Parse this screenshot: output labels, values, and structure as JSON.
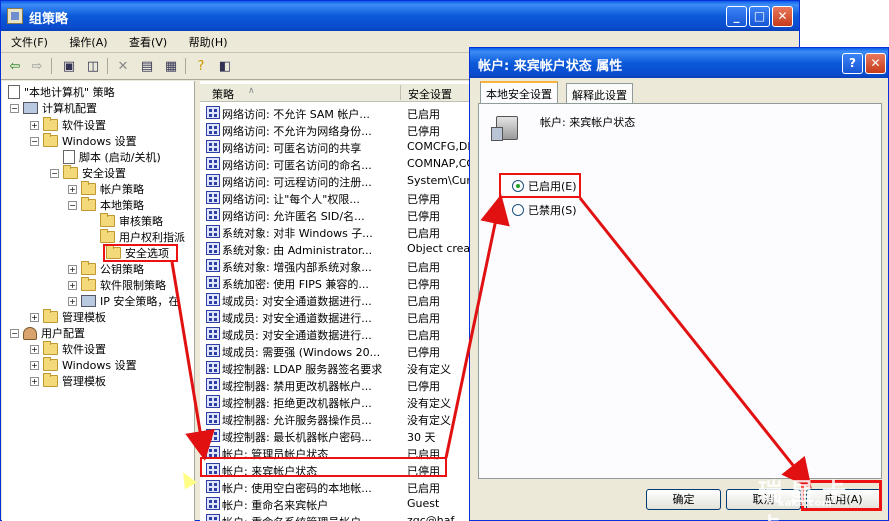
{
  "main": {
    "title": "组策略",
    "controls": {
      "min": "_",
      "max": "□",
      "close": "✕"
    },
    "menu": [
      "文件(F)",
      "操作(A)",
      "查看(V)",
      "帮助(H)"
    ]
  },
  "tree": [
    {
      "label": "\"本地计算机\" 策略",
      "icon": "policy-icon"
    },
    {
      "label": "计算机配置",
      "icon": "computer-icon"
    },
    {
      "label": "软件设置",
      "icon": "folder-icon"
    },
    {
      "label": "Windows 设置",
      "icon": "folder-icon"
    },
    {
      "label": "脚本 (启动/关机)",
      "icon": "script-icon"
    },
    {
      "label": "安全设置",
      "icon": "folder-icon"
    },
    {
      "label": "帐户策略",
      "icon": "folder-icon"
    },
    {
      "label": "本地策略",
      "icon": "folder-icon"
    },
    {
      "label": "审核策略",
      "icon": "folder-icon"
    },
    {
      "label": "用户权利指派",
      "icon": "folder-icon"
    },
    {
      "label": "安全选项",
      "icon": "folder-icon"
    },
    {
      "label": "公钥策略",
      "icon": "folder-icon"
    },
    {
      "label": "软件限制策略",
      "icon": "folder-icon"
    },
    {
      "label": "IP 安全策略，在",
      "icon": "ipsec-icon"
    },
    {
      "label": "管理模板",
      "icon": "folder-icon"
    },
    {
      "label": "用户配置",
      "icon": "user-icon"
    },
    {
      "label": "软件设置",
      "icon": "folder-icon"
    },
    {
      "label": "Windows 设置",
      "icon": "folder-icon"
    },
    {
      "label": "管理模板",
      "icon": "folder-icon"
    }
  ],
  "list": {
    "col_policy": "策略",
    "col_setting": "安全设置",
    "rows": [
      [
        "网络访问: 不允许 SAM 帐户...",
        "已启用"
      ],
      [
        "网络访问: 不允许为网络身份...",
        "已停用"
      ],
      [
        "网络访问: 可匿名访问的共享",
        "COMCFG,DFS$"
      ],
      [
        "网络访问: 可匿名访问的命名...",
        "COMNAP,COMNO"
      ],
      [
        "网络访问: 可远程访问的注册...",
        "System\\Curr"
      ],
      [
        "网络访问: 让\"每个人\"权限...",
        "已停用"
      ],
      [
        "网络访问: 允许匿名 SID/名...",
        "已停用"
      ],
      [
        "系统对象: 对非 Windows 子...",
        "已启用"
      ],
      [
        "系统对象: 由 Administrator...",
        "Object crea"
      ],
      [
        "系统对象: 增强内部系统对象...",
        "已启用"
      ],
      [
        "系统加密: 使用 FIPS 兼容的...",
        "已停用"
      ],
      [
        "域成员: 对安全通道数据进行...",
        "已启用"
      ],
      [
        "域成员: 对安全通道数据进行...",
        "已启用"
      ],
      [
        "域成员: 对安全通道数据进行...",
        "已启用"
      ],
      [
        "域成员: 需要强 (Windows 20...",
        "已停用"
      ],
      [
        "域控制器: LDAP 服务器签名要求",
        "没有定义"
      ],
      [
        "域控制器: 禁用更改机器帐户...",
        "已停用"
      ],
      [
        "域控制器: 拒绝更改机器帐户...",
        "没有定义"
      ],
      [
        "域控制器: 允许服务器操作员...",
        "没有定义"
      ],
      [
        "域控制器: 最长机器帐户密码...",
        "30 天"
      ],
      [
        "帐户: 管理员帐户状态",
        "已启用"
      ],
      [
        "帐户: 来宾帐户状态",
        "已停用"
      ],
      [
        "帐户: 使用空白密码的本地帐...",
        "已启用"
      ],
      [
        "帐户: 重命名来宾帐户",
        "Guest"
      ],
      [
        "帐户: 重命名系统管理员帐户",
        "zgc@haf"
      ]
    ]
  },
  "dialog": {
    "title": "帐户: 来宾帐户状态 属性",
    "help": "?",
    "close": "✕",
    "tabs": [
      "本地安全设置",
      "解释此设置"
    ],
    "policy_name": "帐户: 来宾帐户状态",
    "radio_enabled": "已启用(E)",
    "radio_disabled": "已禁用(S)",
    "ok": "确定",
    "cancel": "取消",
    "apply": "应用(A)"
  },
  "watermark": {
    "text": "瑞星卡卡",
    "sub": "kaka.com"
  },
  "colors": {
    "annotation": "#e11111",
    "titlebar": "#0a5de8"
  }
}
